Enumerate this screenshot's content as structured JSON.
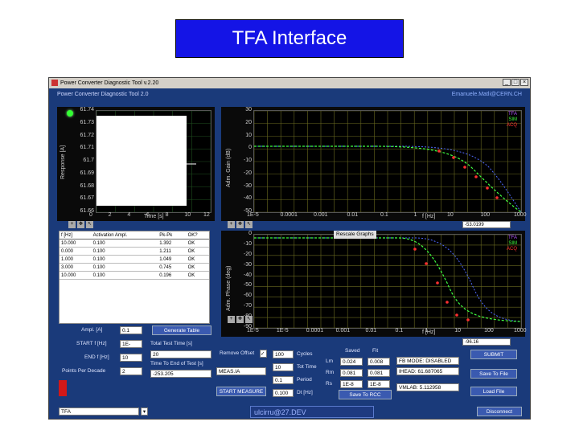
{
  "slide_title": "TFA Interface",
  "window": {
    "title": "Power Converter Diagnostic Tool v.2.20",
    "controls": [
      "_",
      "□",
      "×"
    ]
  },
  "header": {
    "left": "Power Converter Diagnostic Tool 2.0",
    "right": "Emanuele.Matli@CERN.CH"
  },
  "time_graph": {
    "ylabel": "Response [A]",
    "xlabel": "Time [s]",
    "yticks": [
      "61.74",
      "61.73",
      "61.72",
      "61.71",
      "61.7",
      "61.69",
      "61.68",
      "61.67",
      "61.66"
    ],
    "xticks": [
      "0",
      "2",
      "4",
      "6",
      "8",
      "10",
      "12"
    ],
    "led": "green"
  },
  "mag_graph": {
    "ylabel": "Adm. Gain (dB)",
    "xlabel": "f [Hz]",
    "yticks": [
      "30",
      "20",
      "10",
      "0",
      "-10",
      "-20",
      "-30",
      "-40",
      "-50"
    ],
    "xticks": [
      "1E-5",
      "0.0001",
      "0.001",
      "0.01",
      "0.1",
      "1",
      "10",
      "100",
      "1000"
    ],
    "legend": [
      "TFA",
      "SIM",
      "ACQ"
    ],
    "cursor_value": "-53.0199"
  },
  "phase_graph": {
    "ylabel": "Adm. Phase (deg)",
    "xlabel": "f [Hz]",
    "yticks": [
      "0",
      "-10",
      "-20",
      "-30",
      "-40",
      "-50",
      "-60",
      "-70",
      "-80",
      "-90"
    ],
    "xticks": [
      "1E-5",
      "1E-5",
      "0.0001",
      "0.001",
      "0.01",
      "0.1",
      "1",
      "10",
      "100",
      "1000"
    ],
    "legend": [
      "TFA",
      "SIM",
      "ACQ"
    ],
    "cursor_value": "-96.16",
    "rescale_label": "Rescale Graphs"
  },
  "table": {
    "headers": [
      "f [Hz]",
      "Activation Ampl.",
      "Pk-Pk",
      "OK?"
    ],
    "rows": [
      [
        "10.000",
        "0.100",
        "1.392",
        "OK"
      ],
      [
        "0.000",
        "0.100",
        "1.211",
        "OK"
      ],
      [
        "1.000",
        "0.100",
        "1.049",
        "OK"
      ],
      [
        "3.000",
        "0.100",
        "0.745",
        "OK"
      ],
      [
        "10.000",
        "0.100",
        "0.196",
        "OK"
      ]
    ]
  },
  "params": {
    "ampl_label": "Ampl. [A]",
    "ampl_value": "0.1",
    "start_label": "START f [Hz]",
    "start_value": "1E-",
    "end_label": "END f [Hz]",
    "end_value": "10",
    "ppd_label": "Points Per Decade",
    "ppd_value": "2",
    "generate_btn": "Generate Table",
    "total_time_label": "Total Test Time [s]",
    "total_time_value": "20",
    "time_to_end_label": "Time To End of Test [s]",
    "time_to_end_value": "-253.205"
  },
  "measure": {
    "remove_offset_label": "Remove Offset",
    "select_value": "MEAS.IA",
    "start_btn": "START MEASURE",
    "cycles_value": "100",
    "cycles_label": "Cycles",
    "tot_time_value": "10",
    "tot_time_label": "Tot Time",
    "period_value": "0.1",
    "period_label": "Period",
    "dt_value": "0.100",
    "dt_label": "Dt [Hz]"
  },
  "model": {
    "col1": "Saved",
    "col2": "Fit",
    "row_labels": [
      "Lm",
      "Rm",
      "Rs"
    ],
    "saved": [
      "0.024",
      "0.081",
      "1E-8"
    ],
    "fit": [
      "0.008",
      "0.081",
      "1E-8"
    ],
    "save_btn": "Save To RCC"
  },
  "info": {
    "fb_mode": "FB MODE: DISABLED",
    "ihead": "IHEAD: 61.687065",
    "vmlab": "VMLAB: 5.112958"
  },
  "right_buttons": {
    "submit": "SUBMIT",
    "save": "Save To File",
    "load": "Load File"
  },
  "bottom": {
    "select_value": "TFA",
    "status": "ulcirru@27.DEV",
    "disconnect": "Disconnect"
  }
}
